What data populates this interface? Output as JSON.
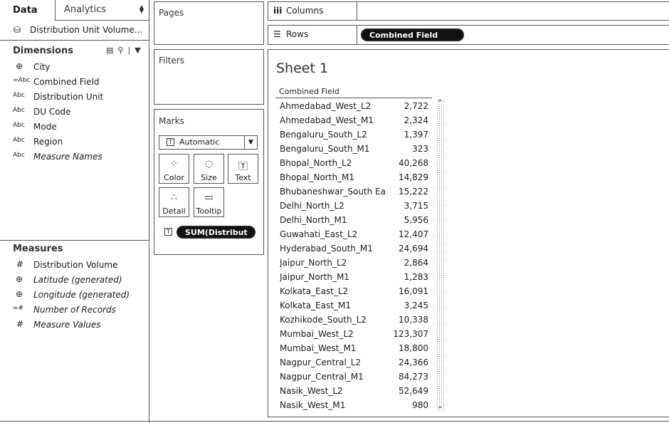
{
  "tabs": {
    "data": "Data",
    "analytics": "Analytics"
  },
  "datasource": {
    "name": "Distribution Unit Volume..."
  },
  "dimensions": {
    "title": "Dimensions",
    "fields": [
      {
        "icon": "⊕",
        "name": "City",
        "italic": false
      },
      {
        "icon": "=Abc",
        "name": "Combined Field",
        "italic": false
      },
      {
        "icon": "Abc",
        "name": "Distribution Unit",
        "italic": false
      },
      {
        "icon": "Abc",
        "name": "DU Code",
        "italic": false
      },
      {
        "icon": "Abc",
        "name": "Mode",
        "italic": false
      },
      {
        "icon": "Abc",
        "name": "Region",
        "italic": false
      },
      {
        "icon": "Abc",
        "name": "Measure Names",
        "italic": true
      }
    ]
  },
  "measures": {
    "title": "Measures",
    "fields": [
      {
        "icon": "#",
        "name": "Distribution Volume",
        "italic": false
      },
      {
        "icon": "⊕",
        "name": "Latitude (generated)",
        "italic": true
      },
      {
        "icon": "⊕",
        "name": "Longitude (generated)",
        "italic": true
      },
      {
        "icon": "=#",
        "name": "Number of Records",
        "italic": true
      },
      {
        "icon": "#",
        "name": "Measure Values",
        "italic": true
      }
    ]
  },
  "pages": {
    "title": "Pages"
  },
  "filters": {
    "title": "Filters"
  },
  "marks": {
    "title": "Marks",
    "type": "Automatic",
    "buttons": {
      "color": "Color",
      "size": "Size",
      "text": "Text",
      "detail": "Detail",
      "tooltip": "Tooltip"
    },
    "pill": "SUM(Distribut"
  },
  "columns": {
    "label": "Columns"
  },
  "rows": {
    "label": "Rows",
    "pill": "Combined Field"
  },
  "sheet": {
    "title": "Sheet 1",
    "column_header": "Combined Field",
    "rows": [
      {
        "label": "Ahmedabad_West_L2",
        "value": "2,722"
      },
      {
        "label": "Ahmedabad_West_M1",
        "value": "2,324"
      },
      {
        "label": "Bengaluru_South_L2",
        "value": "1,397"
      },
      {
        "label": "Bengaluru_South_M1",
        "value": "323"
      },
      {
        "label": "Bhopal_North_L2",
        "value": "40,268"
      },
      {
        "label": "Bhopal_North_M1",
        "value": "14,829"
      },
      {
        "label": "Bhubaneshwar_South Ea..",
        "value": "15,222"
      },
      {
        "label": "Delhi_North_L2",
        "value": "3,715"
      },
      {
        "label": "Delhi_North_M1",
        "value": "5,956"
      },
      {
        "label": "Guwahati_East_L2",
        "value": "12,407"
      },
      {
        "label": "Hyderabad_South_M1",
        "value": "24,694"
      },
      {
        "label": "Jaipur_North_L2",
        "value": "2,864"
      },
      {
        "label": "Jaipur_North_M1",
        "value": "1,283"
      },
      {
        "label": "Kolkata_East_L2",
        "value": "16,091"
      },
      {
        "label": "Kolkata_East_M1",
        "value": "3,245"
      },
      {
        "label": "Kozhikode_South_L2",
        "value": "10,338"
      },
      {
        "label": "Mumbai_West_L2",
        "value": "123,307"
      },
      {
        "label": "Mumbai_West_M1",
        "value": "18,800"
      },
      {
        "label": "Nagpur_Central_L2",
        "value": "24,366"
      },
      {
        "label": "Nagpur_Central_M1",
        "value": "84,273"
      },
      {
        "label": "Nasik_West_L2",
        "value": "52,649"
      },
      {
        "label": "Nasik_West_M1",
        "value": "980"
      }
    ]
  }
}
